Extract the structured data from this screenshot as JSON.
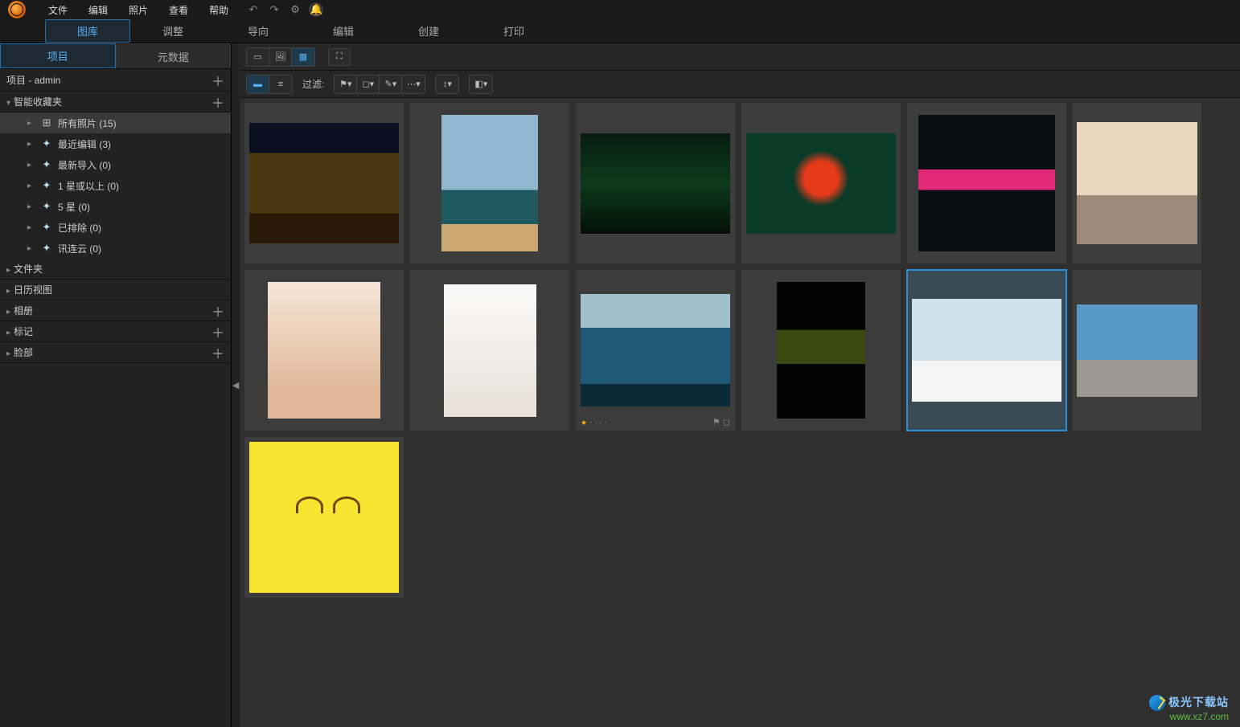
{
  "menu": {
    "file": "文件",
    "edit": "编辑",
    "photo": "照片",
    "view": "查看",
    "help": "帮助"
  },
  "maintabs": {
    "library": "图库",
    "adjust": "调整",
    "guide": "导向",
    "edit": "编辑",
    "create": "创建",
    "print": "打印"
  },
  "sidetabs": {
    "project": "项目",
    "metadata": "元数据"
  },
  "project_header": "项目 - admin",
  "tree": {
    "smart_folders": "智能收藏夹",
    "all_photos": "所有照片 (15)",
    "recent_edit": "最近编辑 (3)",
    "recent_import": "最新导入 (0)",
    "one_star_plus": "1 星或以上 (0)",
    "five_star": "5 星 (0)",
    "excluded": "已排除 (0)",
    "cloud": "讯连云 (0)",
    "folders": "文件夹",
    "calendar": "日历视图",
    "albums": "相册",
    "tags": "标记",
    "faces": "脸部"
  },
  "toolbar": {
    "filter_label": "过滤:"
  },
  "watermark": {
    "name": "极光下载站",
    "url": "www.xz7.com"
  }
}
